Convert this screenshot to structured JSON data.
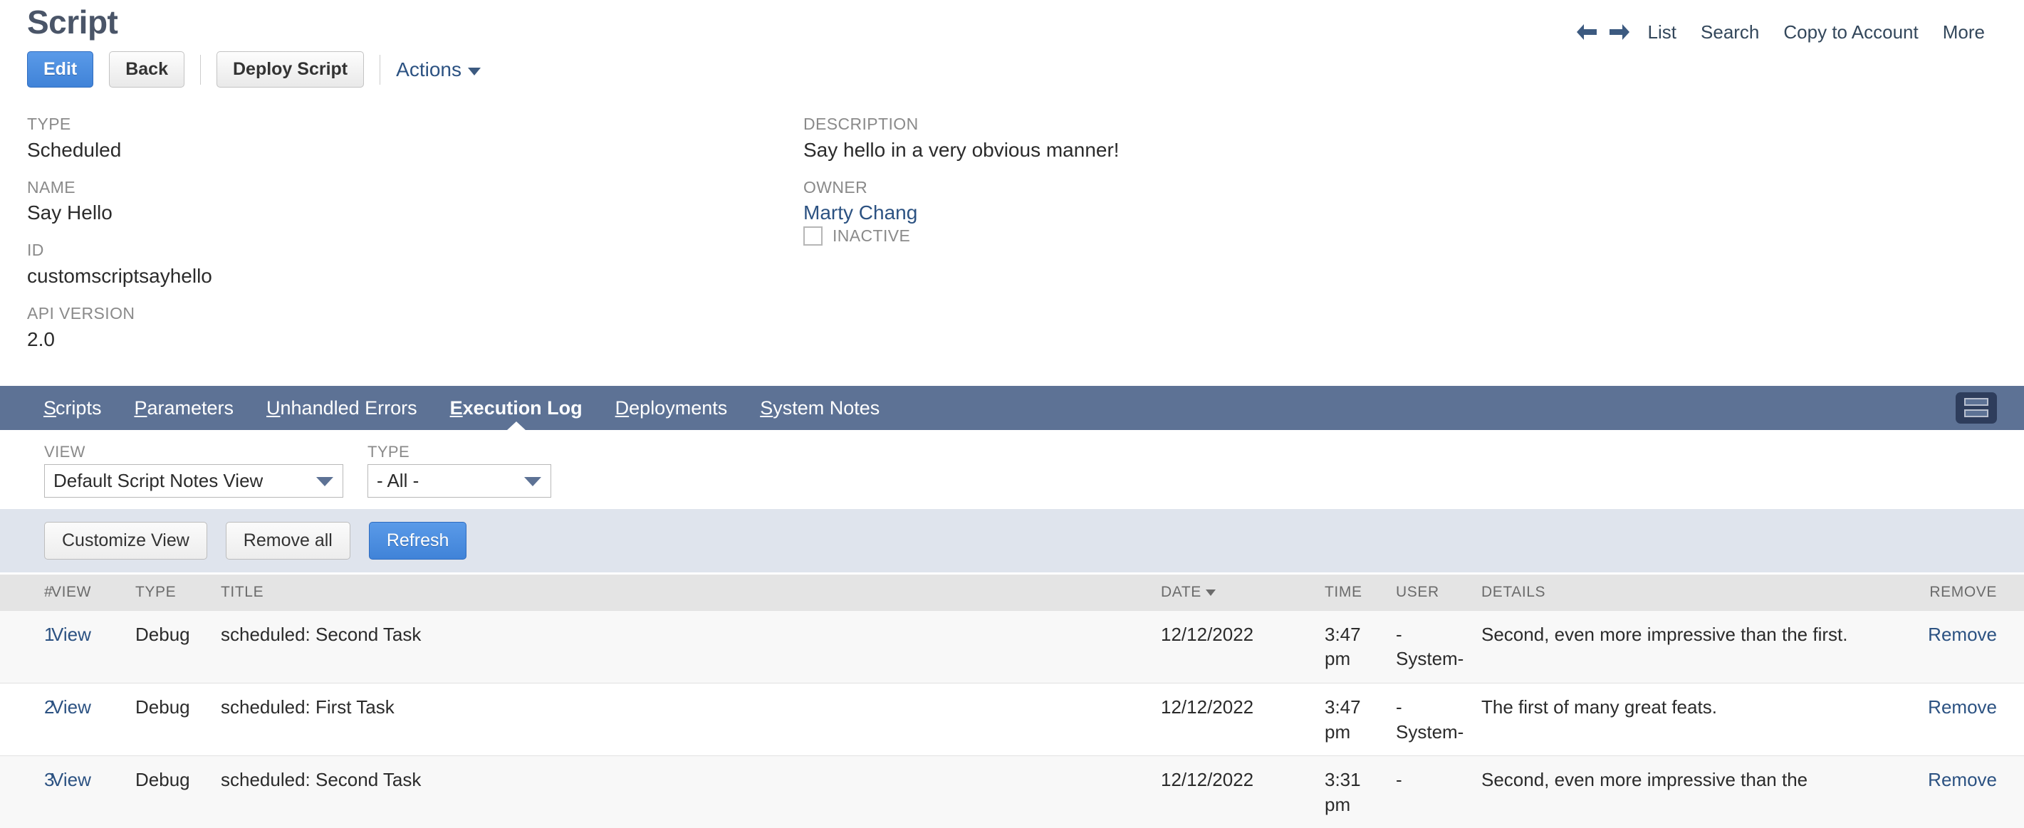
{
  "header": {
    "title": "Script",
    "top_nav": {
      "back_arrow_icon": "arrow-left-icon",
      "forward_arrow_icon": "arrow-right-icon",
      "links": [
        "List",
        "Search",
        "Copy to Account",
        "More"
      ]
    },
    "buttons": {
      "edit": "Edit",
      "back": "Back",
      "deploy": "Deploy Script",
      "actions": "Actions"
    }
  },
  "fields": {
    "left": [
      {
        "label": "TYPE",
        "value": "Scheduled"
      },
      {
        "label": "NAME",
        "value": "Say Hello"
      },
      {
        "label": "ID",
        "value": "customscriptsayhello"
      },
      {
        "label": "API VERSION",
        "value": "2.0"
      }
    ],
    "right": [
      {
        "label": "DESCRIPTION",
        "value": "Say hello in a very obvious manner!"
      },
      {
        "label": "OWNER",
        "value": "Marty Chang"
      }
    ],
    "inactive_label": "INACTIVE",
    "inactive_checked": false
  },
  "tabs": {
    "items": [
      {
        "label": "Scripts",
        "accesskey": "S",
        "active": false
      },
      {
        "label": "Parameters",
        "accesskey": "P",
        "active": false
      },
      {
        "label": "Unhandled Errors",
        "accesskey": "U",
        "active": false
      },
      {
        "label": "Execution Log",
        "accesskey": "E",
        "active": true
      },
      {
        "label": "Deployments",
        "accesskey": "D",
        "active": false
      },
      {
        "label": "System Notes",
        "accesskey": "S",
        "active": false
      }
    ],
    "layout_toggle_icon": "layout-rows-icon"
  },
  "filters": {
    "view": {
      "label": "VIEW",
      "value": "Default Script Notes View"
    },
    "type": {
      "label": "TYPE",
      "value": "- All -"
    }
  },
  "action_band": {
    "customize_view": "Customize View",
    "remove_all": "Remove all",
    "refresh": "Refresh"
  },
  "table": {
    "columns": [
      "#",
      "VIEW",
      "TYPE",
      "TITLE",
      "DATE",
      "TIME",
      "USER",
      "DETAILS",
      "REMOVE"
    ],
    "sorted_column": "DATE",
    "sort_direction": "desc",
    "rows": [
      {
        "num": "1",
        "view": "View",
        "type": "Debug",
        "title": "scheduled: Second Task",
        "date": "12/12/2022",
        "time": "3:47 pm",
        "user": "-System-",
        "details": "Second, even more impressive than the first.",
        "remove": "Remove"
      },
      {
        "num": "2",
        "view": "View",
        "type": "Debug",
        "title": "scheduled: First Task",
        "date": "12/12/2022",
        "time": "3:47 pm",
        "user": "-System-",
        "details": "The first of many great feats.",
        "remove": "Remove"
      },
      {
        "num": "3",
        "view": "View",
        "type": "Debug",
        "title": "scheduled: Second Task",
        "date": "12/12/2022",
        "time": "3:31 pm",
        "user": "-",
        "details": "Second, even more impressive than the",
        "remove": "Remove"
      }
    ]
  },
  "colors": {
    "accent_blue": "#4083d8",
    "tabbar": "#5d7295",
    "link": "#2c5282",
    "band": "#dfe4ed",
    "table_header": "#e4e4e4"
  }
}
